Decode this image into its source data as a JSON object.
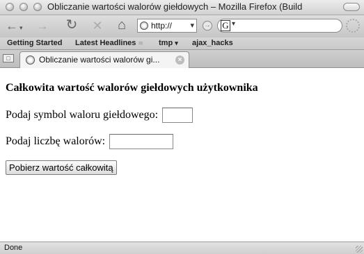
{
  "window": {
    "title": "Obliczanie wartości walorów giełdowych – Mozilla Firefox (Build"
  },
  "toolbar": {
    "url": "http://",
    "search_engine_glyph": "G"
  },
  "bookmarks": {
    "items": [
      {
        "label": "Getting Started"
      },
      {
        "label": "Latest Headlines"
      },
      {
        "label": "tmp"
      },
      {
        "label": "ajax_hacks"
      }
    ]
  },
  "tabs": [
    {
      "label": "Obliczanie wartości walorów gi...",
      "active": true
    }
  ],
  "page": {
    "heading": "Całkowita wartość walorów giełdowych użytkownika",
    "symbol_label": "Podaj symbol waloru giełdowego:",
    "symbol_value": "",
    "quantity_label": "Podaj liczbę walorów:",
    "quantity_value": "",
    "submit_label": "Pobierz wartość całkowitą"
  },
  "status": {
    "text": "Done"
  },
  "icons": {
    "back": "back-arrow-icon",
    "forward": "forward-arrow-icon",
    "reload": "reload-icon",
    "stop": "stop-icon",
    "home": "home-icon",
    "site": "globe-icon",
    "go": "go-arrow-icon",
    "search_engine": "google-icon",
    "throbber": "throbber-icon",
    "rss": "rss-feed-icon",
    "tab_close": "close-icon"
  }
}
